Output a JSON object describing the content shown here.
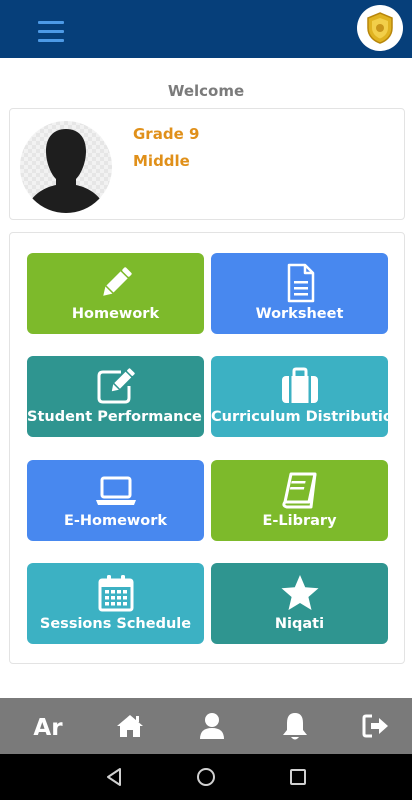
{
  "app": {
    "menu_icon": "hamburger-menu-icon",
    "logo_icon": "school-emblem-logo"
  },
  "welcome": "Welcome",
  "profile": {
    "grade": "Grade 9",
    "level": "Middle",
    "avatar_icon": "user-silhouette"
  },
  "tiles": [
    {
      "label": "Homework",
      "icon": "pencil-icon",
      "color": "#7dba2b"
    },
    {
      "label": "Worksheet",
      "icon": "document-icon",
      "color": "#4888ef"
    },
    {
      "label": "Student Performance Re",
      "icon": "edit-square-icon",
      "color": "#2f9590"
    },
    {
      "label": "Curriculum Distribution",
      "icon": "briefcase-icon",
      "color": "#3cb1c3"
    },
    {
      "label": "E-Homework",
      "icon": "laptop-icon",
      "color": "#4888ef"
    },
    {
      "label": "E-Library",
      "icon": "book-icon",
      "color": "#7dba2b"
    },
    {
      "label": "Sessions Schedule",
      "icon": "calendar-icon",
      "color": "#3cb1c3"
    },
    {
      "label": "Niqati",
      "icon": "star-icon",
      "color": "#2f9590"
    }
  ],
  "bottom_nav": {
    "language_label": "Ar",
    "items": [
      "home-icon",
      "user-icon",
      "bell-icon",
      "logout-icon"
    ]
  },
  "colors": {
    "appbar": "#063f7a",
    "accent_text": "#e0901a",
    "bottom_bar": "#7a7a7a"
  }
}
